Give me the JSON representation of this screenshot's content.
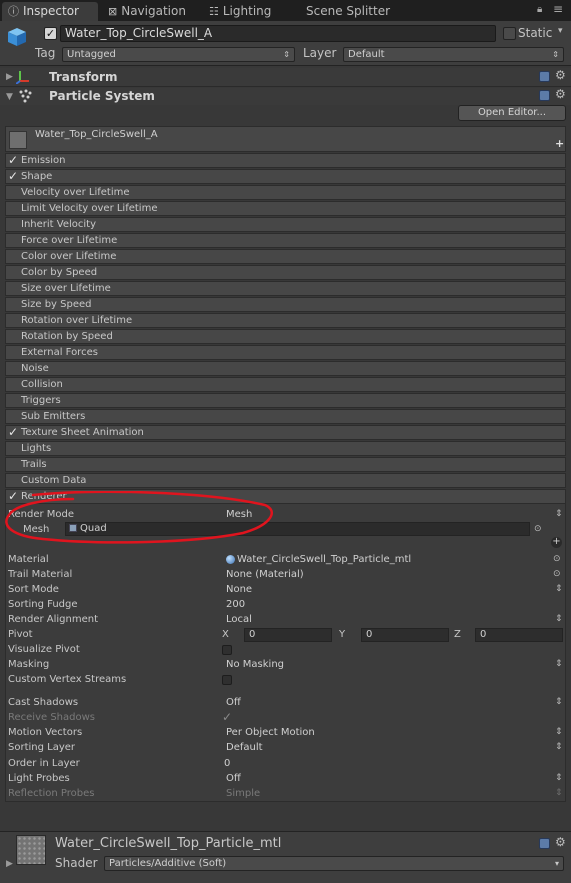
{
  "tabs": [
    {
      "label": "Inspector",
      "icon": "info-icon"
    },
    {
      "label": "Navigation",
      "icon": "navigation-icon"
    },
    {
      "label": "Lighting",
      "icon": "lighting-icon"
    },
    {
      "label": "Scene Splitter",
      "icon": ""
    }
  ],
  "object": {
    "name": "Water_Top_CircleSwell_A",
    "static_label": "Static",
    "tag_label": "Tag",
    "tag_value": "Untagged",
    "layer_label": "Layer",
    "layer_value": "Default"
  },
  "components": {
    "transform": "Transform",
    "particle_system": "Particle System",
    "open_editor": "Open Editor..."
  },
  "particle_system": {
    "name": "Water_Top_CircleSwell_A",
    "add_symbol": "+",
    "modules": [
      {
        "label": "Emission",
        "checked": true
      },
      {
        "label": "Shape",
        "checked": true
      },
      {
        "label": "Velocity over Lifetime",
        "checked": false
      },
      {
        "label": "Limit Velocity over Lifetime",
        "checked": false
      },
      {
        "label": "Inherit Velocity",
        "checked": false
      },
      {
        "label": "Force over Lifetime",
        "checked": false
      },
      {
        "label": "Color over Lifetime",
        "checked": false
      },
      {
        "label": "Color by Speed",
        "checked": false
      },
      {
        "label": "Size over Lifetime",
        "checked": false
      },
      {
        "label": "Size by Speed",
        "checked": false
      },
      {
        "label": "Rotation over Lifetime",
        "checked": false
      },
      {
        "label": "Rotation by Speed",
        "checked": false
      },
      {
        "label": "External Forces",
        "checked": false
      },
      {
        "label": "Noise",
        "checked": false
      },
      {
        "label": "Collision",
        "checked": false
      },
      {
        "label": "Triggers",
        "checked": false
      },
      {
        "label": "Sub Emitters",
        "checked": false
      },
      {
        "label": "Texture Sheet Animation",
        "checked": true
      },
      {
        "label": "Lights",
        "checked": false
      },
      {
        "label": "Trails",
        "checked": false
      },
      {
        "label": "Custom Data",
        "checked": false
      },
      {
        "label": "Renderer",
        "checked": true
      }
    ]
  },
  "renderer": {
    "render_mode": {
      "label": "Render Mode",
      "value": "Mesh"
    },
    "mesh": {
      "label": "Mesh",
      "value": "Quad"
    },
    "material": {
      "label": "Material",
      "value": "Water_CircleSwell_Top_Particle_mtl"
    },
    "trail_material": {
      "label": "Trail Material",
      "value": "None (Material)"
    },
    "sort_mode": {
      "label": "Sort Mode",
      "value": "None"
    },
    "sorting_fudge": {
      "label": "Sorting Fudge",
      "value": "200"
    },
    "render_alignment": {
      "label": "Render Alignment",
      "value": "Local"
    },
    "pivot": {
      "label": "Pivot",
      "x_label": "X",
      "x": "0",
      "y_label": "Y",
      "y": "0",
      "z_label": "Z",
      "z": "0"
    },
    "visualize_pivot": {
      "label": "Visualize Pivot"
    },
    "masking": {
      "label": "Masking",
      "value": "No Masking"
    },
    "custom_vertex_streams": {
      "label": "Custom Vertex Streams"
    },
    "cast_shadows": {
      "label": "Cast Shadows",
      "value": "Off"
    },
    "receive_shadows": {
      "label": "Receive Shadows",
      "checked": true
    },
    "motion_vectors": {
      "label": "Motion Vectors",
      "value": "Per Object Motion"
    },
    "sorting_layer": {
      "label": "Sorting Layer",
      "value": "Default"
    },
    "order_in_layer": {
      "label": "Order in Layer",
      "value": "0"
    },
    "light_probes": {
      "label": "Light Probes",
      "value": "Off"
    },
    "reflection_probes": {
      "label": "Reflection Probes",
      "value": "Simple"
    }
  },
  "material_footer": {
    "name": "Water_CircleSwell_Top_Particle_mtl",
    "shader_label": "Shader",
    "shader_value": "Particles/Additive (Soft)"
  },
  "colors": {
    "background": "#383838",
    "tabbar": "#1f1f1f",
    "annotation_red": "#e0141e"
  }
}
